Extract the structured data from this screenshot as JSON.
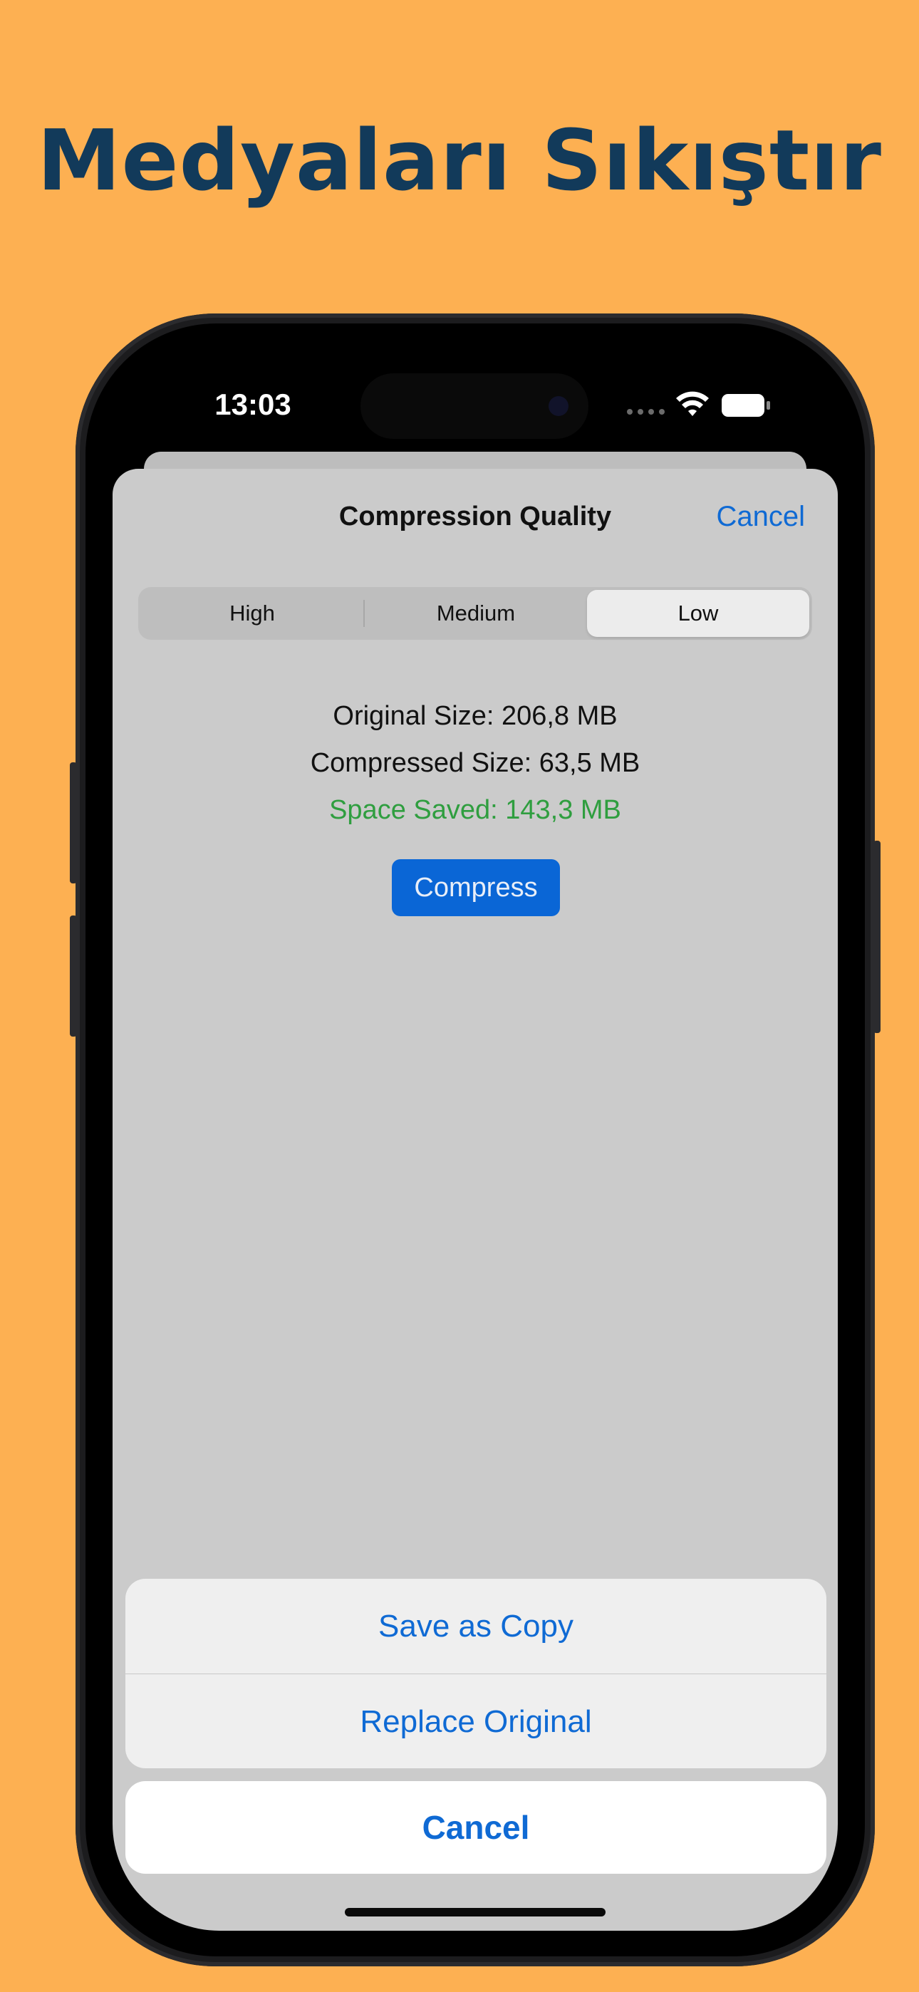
{
  "headline": "Medyaları Sıkıştır",
  "status_bar": {
    "time": "13:03",
    "wifi_icon": "wifi-icon",
    "battery_icon": "battery-full-icon"
  },
  "sheet": {
    "title": "Compression Quality",
    "cancel_label": "Cancel",
    "segments": [
      {
        "label": "High",
        "selected": false
      },
      {
        "label": "Medium",
        "selected": false
      },
      {
        "label": "Low",
        "selected": true
      }
    ],
    "original_size": "Original Size: 206,8 MB",
    "compressed_size": "Compressed Size: 63,5 MB",
    "space_saved": "Space Saved: 143,3 MB",
    "compress_label": "Compress"
  },
  "action_sheet": {
    "items": [
      "Save as Copy",
      "Replace Original"
    ],
    "cancel_label": "Cancel"
  },
  "colors": {
    "background": "#FDB052",
    "headline": "#123A5A",
    "accent": "#0F6AD4",
    "saved_green": "#2F9E3F",
    "button_blue": "#0A66D6"
  }
}
